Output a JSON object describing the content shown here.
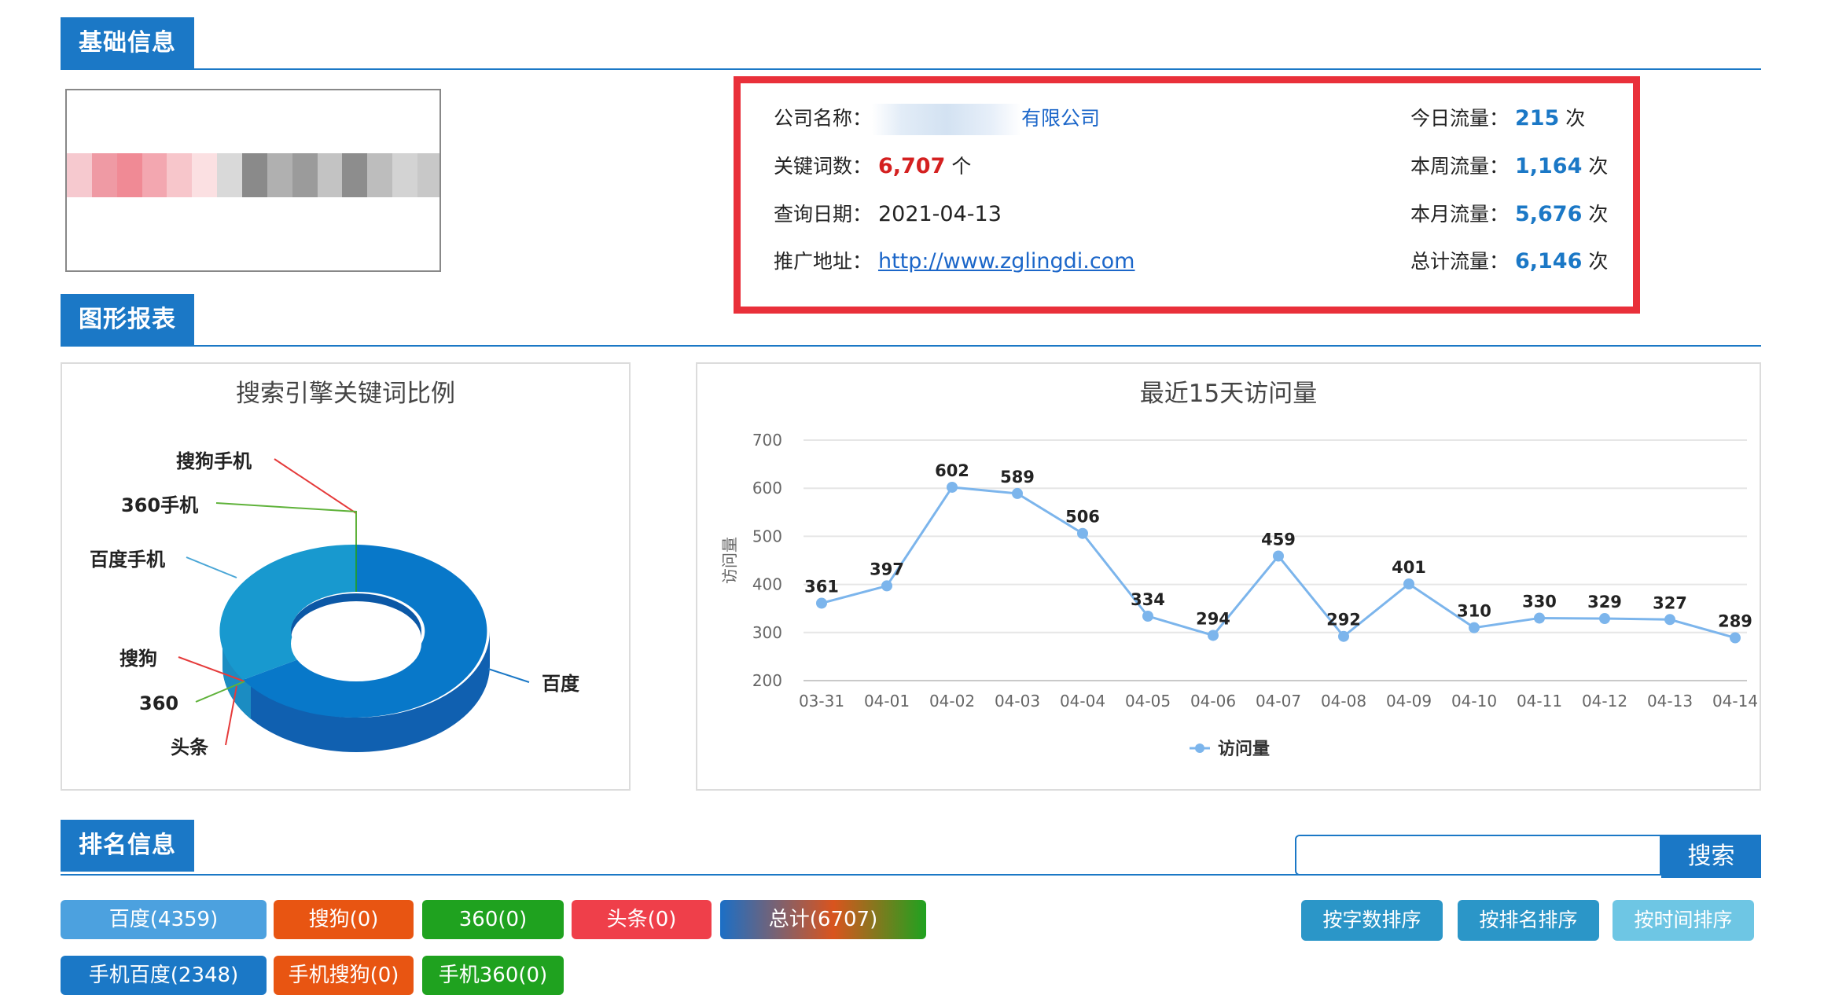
{
  "sections": {
    "basic": "基础信息",
    "charts": "图形报表",
    "ranking": "排名信息"
  },
  "info": {
    "company_label": "公司名称：",
    "company_value_visible": "有限公司",
    "keywords_label": "关键词数：",
    "keywords_value": "6,707",
    "keywords_unit": "个",
    "query_date_label": "查询日期：",
    "query_date_value": "2021-04-13",
    "promo_label": "推广地址：",
    "promo_value": "http://www.zglingdi.com",
    "today_label": "今日流量：",
    "today_value": "215",
    "week_label": "本周流量：",
    "week_value": "1,164",
    "month_label": "本月流量：",
    "month_value": "5,676",
    "total_label": "总计流量：",
    "total_value": "6,146",
    "unit": "次"
  },
  "pie": {
    "title": "搜索引擎关键词比例",
    "labels": [
      "搜狗手机",
      "360手机",
      "百度手机",
      "搜狗",
      "360",
      "头条",
      "百度"
    ]
  },
  "chart_data": {
    "type": "line",
    "title": "最近15天访问量",
    "ylabel": "访问量",
    "xlabel": "",
    "x": [
      "03-31",
      "04-01",
      "04-02",
      "04-03",
      "04-04",
      "04-05",
      "04-06",
      "04-07",
      "04-08",
      "04-09",
      "04-10",
      "04-11",
      "04-12",
      "04-13",
      "04-14"
    ],
    "series": [
      {
        "name": "访问量",
        "values": [
          361,
          397,
          602,
          589,
          506,
          334,
          294,
          459,
          292,
          401,
          310,
          330,
          329,
          327,
          289
        ]
      }
    ],
    "ylim": [
      200,
      700
    ],
    "yticks": [
      200,
      300,
      400,
      500,
      600,
      700
    ],
    "grid": true,
    "legend": "bottom",
    "color": "#7cb5ec"
  },
  "search": {
    "placeholder": "",
    "button": "搜索"
  },
  "engine_buttons": [
    {
      "label": "百度(4359)",
      "color": "#4ca1df"
    },
    {
      "label": "搜狗(0)",
      "color": "#e85512"
    },
    {
      "label": "360(0)",
      "color": "#1fa21f"
    },
    {
      "label": "头条(0)",
      "color": "#ef3f4a"
    },
    {
      "label": "总计(6707)",
      "color": "#1b6fc6"
    },
    {
      "label": "手机百度(2348)",
      "color": "#1b78c6"
    },
    {
      "label": "手机搜狗(0)",
      "color": "#e85512"
    },
    {
      "label": "手机360(0)",
      "color": "#1fa21f"
    }
  ],
  "sort_buttons": [
    {
      "label": "按字数排序",
      "color": "#2b96c8"
    },
    {
      "label": "按排名排序",
      "color": "#2b96c8"
    },
    {
      "label": "按时间排序",
      "color": "#6ec6e4"
    }
  ]
}
